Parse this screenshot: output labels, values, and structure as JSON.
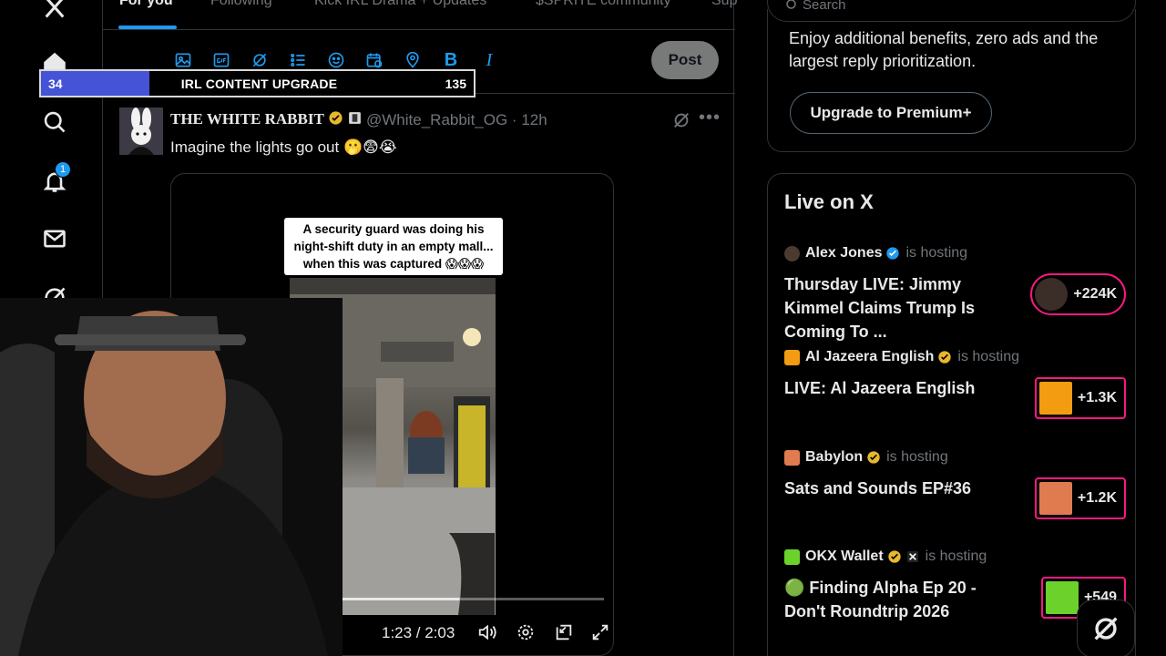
{
  "tabs": [
    {
      "label": "For you",
      "active": true
    },
    {
      "label": "Following",
      "active": false
    },
    {
      "label": "Kick IRL Drama + Updates",
      "active": false
    },
    {
      "label": "$SPRITE community",
      "active": false
    },
    {
      "label": "Sup",
      "active": false
    }
  ],
  "nav": {
    "notifications_count": "1",
    "icons": [
      "x-logo-icon",
      "home-icon",
      "search-icon",
      "bell-icon",
      "mail-icon",
      "grok-icon"
    ]
  },
  "composer": {
    "post_label": "Post",
    "tools": [
      "image-icon",
      "gif-icon",
      "grok-icon",
      "list-icon",
      "emoji-icon",
      "schedule-icon",
      "location-icon",
      "bold-icon",
      "italic-icon"
    ]
  },
  "tweet": {
    "name": "THE WHITE RABBIT",
    "handle": "@White_Rabbit_OG · 12h",
    "text": "Imagine the lights go out 🫢😨😭",
    "video_caption": "A security guard was doing his night-shift duty in an empty mall... when this was captured 😱😱😱",
    "video_time": "1:23 / 2:03",
    "video_progress": 0.45
  },
  "right": {
    "search_placeholder": "Search",
    "premium_text": "Enjoy additional benefits, zero ads and the largest reply prioritization.",
    "premium_button": "Upgrade to Premium+",
    "live_title": "Live on X",
    "live_items": [
      {
        "host": "Alex Jones",
        "suffix": "is hosting",
        "title": "Thursday LIVE: Jimmy Kimmel Claims Trump Is Coming To ...",
        "count": "+224K",
        "badge": "blue"
      },
      {
        "host": "Al Jazeera English",
        "suffix": "is hosting",
        "title": "LIVE: Al Jazeera English",
        "count": "+1.3K",
        "badge": "gold"
      },
      {
        "host": "Babylon",
        "suffix": "is hosting",
        "title": "Sats and Sounds EP#36",
        "count": "+1.2K",
        "badge": "gold"
      },
      {
        "host": "OKX Wallet",
        "suffix": "is hosting",
        "title": "🟢 Finding Alpha Ep 20 - Don't Roundtrip 2026",
        "count": "+549",
        "badge": "gold"
      }
    ]
  },
  "stream_overlay": {
    "left_value": "34",
    "label": "IRL CONTENT UPGRADE",
    "right_value": "135",
    "progress": 0.25
  },
  "colors": {
    "accent": "#1d9bf0",
    "live_border": "#f91880",
    "verified_gold": "#e8b82b",
    "verified_blue": "#1d9bf0",
    "upgrade_fill": "#4553d6"
  }
}
